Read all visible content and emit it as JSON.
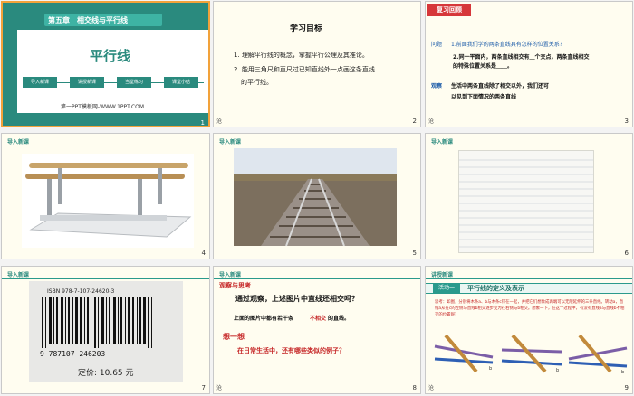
{
  "slides": [
    {
      "num": "1",
      "chapter": "第五章　相交线与平行线",
      "title": "平行线",
      "nav": [
        "导入新课",
        "讲授新课",
        "当堂练习",
        "课堂小结"
      ],
      "footer": "第一PPT模板网-WWW.1PPT.COM"
    },
    {
      "num": "2",
      "heading": "学习目标",
      "goals": [
        "1. 理解平行线的概念，掌握平行公理及其推论。",
        "2. 能用三角尺和直尺过已知直线外一点画这条直线",
        "的平行线。"
      ],
      "note": "沧"
    },
    {
      "num": "3",
      "tag": "复习回顾",
      "q_label": "问题",
      "q1": "1.前面我们学的两条直线具有怎样的位置关系？",
      "q2a": "2.同一平面内，两条直线相交有＿个交点，两条直线相交",
      "q2b": "的特殊位置关系是＿＿。",
      "obs_label": "观察",
      "obs1": "生活中两条直线除了相交以外，我们还可",
      "obs2": "以见到下面情况的两条直线",
      "note": "沧"
    },
    {
      "num": "4",
      "label": "导入新课"
    },
    {
      "num": "5",
      "label": "导入新课"
    },
    {
      "num": "6",
      "label": "导入新课"
    },
    {
      "num": "7",
      "label": "导入新课",
      "isbn": "ISBN 978-7-107-24620-3",
      "barcode_num": "9 787107 246203",
      "price": "定价: 10.65 元"
    },
    {
      "num": "8",
      "label": "导入新课",
      "sec1": "观察与思考",
      "line1": "通过观察，上述图片中直线还相交吗？",
      "line2a": "上面的图片中都有若干条",
      "line2b": "不相交",
      "line2c": "的直线。",
      "sec2": "想一想",
      "line3": "在日常生活中，还有哪些类似的例子？",
      "note": "沧"
    },
    {
      "num": "9",
      "label": "讲授新课",
      "tag": "活动一",
      "tag_title": "平行线的定义及表示",
      "think": "思考：如图，分别将木条a、b与木条c钉在一起，并把它们想象成两端可以无限延伸的三条直线。转动a，直线a从在c的左侧与直线b相交逐步变为在右侧与b相交。想象一下，在这个过程中，有没有直线a与直线b不相交的位置呢？",
      "note": "沧"
    }
  ]
}
